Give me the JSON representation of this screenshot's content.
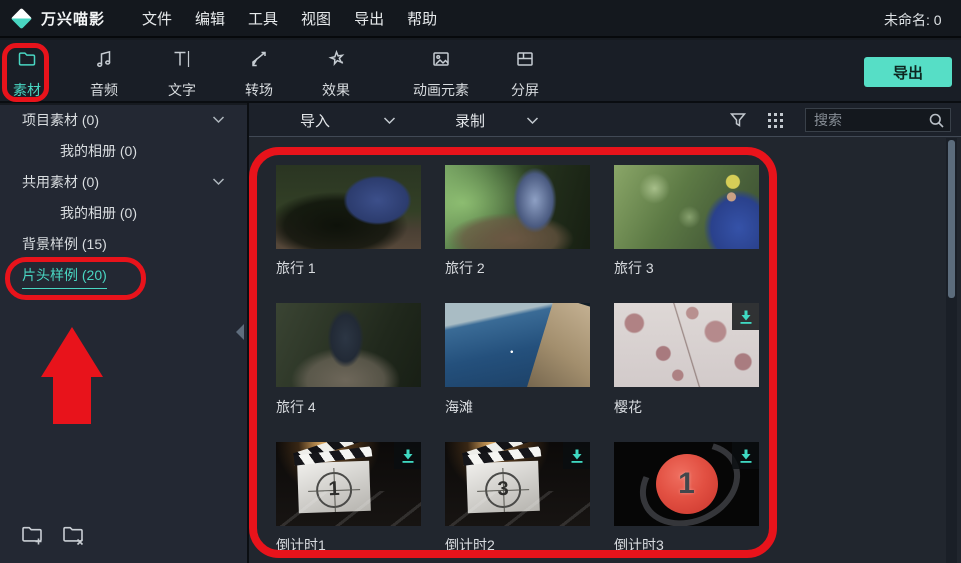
{
  "colors": {
    "accent": "#49d6c2",
    "annotation_red": "#e8131b",
    "export_bg": "#56dec6"
  },
  "app": {
    "logo_text": "万兴喵影",
    "menu": [
      "文件",
      "编辑",
      "工具",
      "视图",
      "导出",
      "帮助"
    ],
    "project_title": "未命名: 0",
    "export_label": "导出"
  },
  "tabs": [
    {
      "label": "素材",
      "icon": "folder-icon",
      "active": true
    },
    {
      "label": "音频",
      "icon": "music-note-icon",
      "active": false
    },
    {
      "label": "文字",
      "icon": "text-icon",
      "active": false
    },
    {
      "label": "转场",
      "icon": "transition-icon",
      "active": false
    },
    {
      "label": "效果",
      "icon": "effects-star-icon",
      "active": false
    },
    {
      "label": "动画元素",
      "icon": "image-icon",
      "active": false
    },
    {
      "label": "分屏",
      "icon": "split-screen-icon",
      "active": false
    }
  ],
  "sidebar": {
    "items": [
      {
        "label": "项目素材 (0)",
        "indent": 0,
        "chevron": true,
        "selected": false
      },
      {
        "label": "我的相册 (0)",
        "indent": 1,
        "chevron": false,
        "selected": false
      },
      {
        "label": "共用素材 (0)",
        "indent": 0,
        "chevron": true,
        "selected": false
      },
      {
        "label": "我的相册 (0)",
        "indent": 1,
        "chevron": false,
        "selected": false
      },
      {
        "label": "背景样例 (15)",
        "indent": 0,
        "chevron": false,
        "selected": false
      },
      {
        "label": "片头样例 (20)",
        "indent": 0,
        "chevron": false,
        "selected": true
      }
    ]
  },
  "content": {
    "header": {
      "import_label": "导入",
      "record_label": "录制",
      "search_placeholder": "搜索"
    },
    "thumbnails": [
      {
        "label": "旅行 1",
        "downloadable": false
      },
      {
        "label": "旅行 2",
        "downloadable": false
      },
      {
        "label": "旅行 3",
        "downloadable": false
      },
      {
        "label": "旅行 4",
        "downloadable": false
      },
      {
        "label": "海滩",
        "downloadable": true
      },
      {
        "label": "樱花",
        "downloadable": true
      },
      {
        "label": "倒计时1",
        "downloadable": true,
        "number": "1"
      },
      {
        "label": "倒计时2",
        "downloadable": true,
        "number": "3"
      },
      {
        "label": "倒计时3",
        "downloadable": true,
        "number": "1"
      }
    ]
  }
}
